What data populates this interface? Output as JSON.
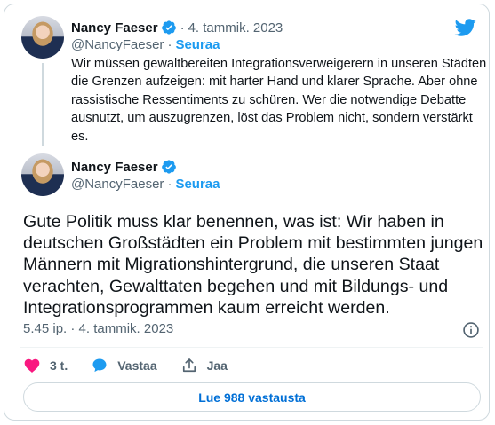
{
  "quoted_tweet": {
    "display_name": "Nancy Faeser",
    "date": "4. tammik. 2023",
    "handle": "@NancyFaeser",
    "separator": "·",
    "follow_label": "Seuraa",
    "text": "Wir müssen gewaltbereiten Integrationsverweigerern in unseren Städten die Grenzen aufzeigen: mit harter Hand und klarer Sprache. Aber ohne rassistische Ressentiments zu schüren. Wer die notwendige Debatte ausnutzt, um auszugrenzen, löst das Problem nicht, sondern verstärkt es."
  },
  "main_tweet": {
    "display_name": "Nancy Faeser",
    "handle": "@NancyFaeser",
    "separator": "·",
    "follow_label": "Seuraa",
    "text": "Gute Politik muss klar benennen, was ist: Wir haben in deutschen Großstädten ein Problem mit bestimmten jungen Männern mit Migrationshintergrund, die unseren Staat verachten, Gewalttaten begehen und mit Bildungs- und Integrationsprogrammen kaum erreicht werden.",
    "timestamp": "5.45 ip. · 4. tammik. 2023"
  },
  "actions": {
    "like_count": "3 t.",
    "reply_label": "Vastaa",
    "share_label": "Jaa"
  },
  "read_replies_label": "Lue 988 vastausta",
  "colors": {
    "brand_blue": "#1d9bf0",
    "like_pink": "#f91880",
    "text_secondary": "#536471",
    "border": "#cfd9de"
  },
  "icons": [
    "twitter-bird-icon",
    "verified-badge-icon",
    "info-icon",
    "heart-icon",
    "speech-bubble-icon",
    "share-icon"
  ]
}
